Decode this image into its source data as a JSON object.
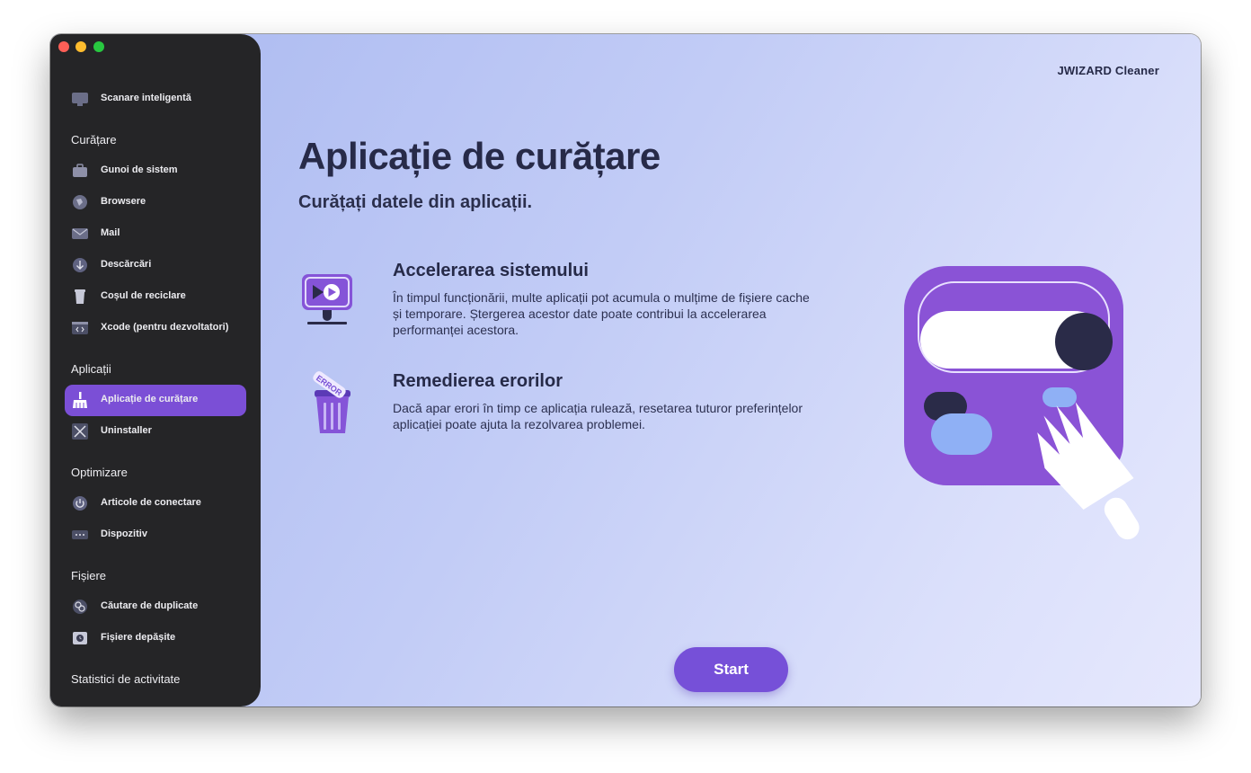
{
  "app": {
    "brand": "JWIZARD Cleaner"
  },
  "sidebar": {
    "smart_scan": "Scanare inteligentă",
    "sections": {
      "cleaning": "Curățare",
      "apps": "Aplicații",
      "optimize": "Optimizare",
      "files": "Fișiere",
      "activity": "Statistici de activitate"
    },
    "items": {
      "system_junk": "Gunoi de sistem",
      "browsers": "Browsere",
      "mail": "Mail",
      "downloads": "Descărcări",
      "trash": "Coșul de reciclare",
      "xcode": "Xcode (pentru dezvoltatori)",
      "app_cleaner": "Aplicație de curățare",
      "uninstaller": "Uninstaller",
      "login_items": "Articole de conectare",
      "devices": "Dispozitiv",
      "duplicates": "Căutare de duplicate",
      "outdated": "Fișiere depășite"
    },
    "active_item": "app_cleaner"
  },
  "main": {
    "title": "Aplicație de curățare",
    "subtitle": "Curățați datele din aplicații.",
    "features": [
      {
        "title": "Accelerarea sistemului",
        "description": "În timpul funcționării, multe aplicații pot acumula o mulțime de fișiere cache și temporare. Ștergerea acestor date poate contribui la accelerarea performanței acestora.",
        "icon": "monitor-play-icon"
      },
      {
        "title": "Remedierea erorilor",
        "description": "Dacă apar erori în timp ce aplicația rulează, resetarea tuturor preferințelor aplicației poate ajuta la rezolvarea problemei.",
        "icon": "trash-error-icon",
        "icon_label": "ERROR"
      }
    ],
    "start_label": "Start"
  },
  "colors": {
    "accent": "#7b4fd6",
    "sidebar_bg": "#252527",
    "text_dark": "#272a48"
  }
}
